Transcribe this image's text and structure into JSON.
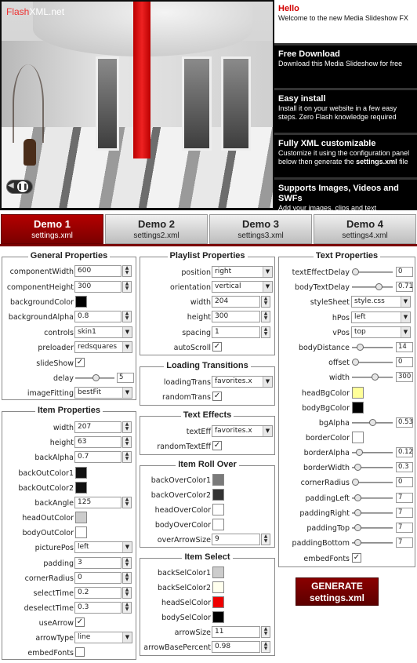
{
  "hero": {
    "logo_brand": "Flash",
    "logo_rest": "XML.net",
    "player_icon": "pause-icon",
    "items": [
      {
        "title": "Hello",
        "text": "Welcome to the new Media Slideshow FX"
      },
      {
        "title": "Free Download",
        "text": "Download this Media Slideshow for free"
      },
      {
        "title": "Easy install",
        "text": "Install it on your website in a few easy steps. Zero Flash knowledge required"
      },
      {
        "title": "Fully XML customizable",
        "text": "Customize it using the configuration panel below then generate the ",
        "text_bold": "settings.xml",
        "text_end": " file"
      },
      {
        "title": "Supports Images, Videos and SWFs",
        "text": "Add your images, clips and text"
      }
    ]
  },
  "tabs": [
    {
      "label": "Demo 1",
      "file": "settings.xml",
      "active": true
    },
    {
      "label": "Demo 2",
      "file": "settings2.xml"
    },
    {
      "label": "Demo 3",
      "file": "settings3.xml"
    },
    {
      "label": "Demo 4",
      "file": "settings4.xml"
    }
  ],
  "general": {
    "title": "General Properties",
    "componentWidth": {
      "label": "componentWidth",
      "value": "600"
    },
    "componentHeight": {
      "label": "componentHeight",
      "value": "300"
    },
    "backgroundColor": {
      "label": "backgroundColor",
      "color": "#000000"
    },
    "backgroundAlpha": {
      "label": "backgroundAlpha",
      "value": "0.8"
    },
    "controls": {
      "label": "controls",
      "value": "skin1"
    },
    "preloader": {
      "label": "preloader",
      "value": "redsquares"
    },
    "slideShow": {
      "label": "slideShow",
      "checked": true
    },
    "delay": {
      "label": "delay",
      "value": "5",
      "level": 0.5
    },
    "imageFitting": {
      "label": "imageFitting",
      "value": "bestFit"
    }
  },
  "item": {
    "title": "Item Properties",
    "width": {
      "label": "width",
      "value": "207"
    },
    "height": {
      "label": "height",
      "value": "63"
    },
    "backAlpha": {
      "label": "backAlpha",
      "value": "0.7"
    },
    "backOutColor1": {
      "label": "backOutColor1",
      "color": "#111111"
    },
    "backOutColor2": {
      "label": "backOutColor2",
      "color": "#111111"
    },
    "backAngle": {
      "label": "backAngle",
      "value": "125"
    },
    "headOutColor": {
      "label": "headOutColor",
      "color": "#cccccc"
    },
    "bodyOutColor": {
      "label": "bodyOutColor",
      "color": "#ffffff"
    },
    "picturePos": {
      "label": "picturePos",
      "value": "left"
    },
    "padding": {
      "label": "padding",
      "value": "3"
    },
    "cornerRadius": {
      "label": "cornerRadius",
      "value": "0"
    },
    "selectTime": {
      "label": "selectTime",
      "value": "0.2"
    },
    "deselectTime": {
      "label": "deselectTime",
      "value": "0.3"
    },
    "useArrow": {
      "label": "useArrow",
      "checked": true
    },
    "arrowType": {
      "label": "arrowType",
      "value": "line"
    },
    "embedFonts": {
      "label": "embedFonts",
      "checked": false
    }
  },
  "playlist": {
    "title": "Playlist Properties",
    "position": {
      "label": "position",
      "value": "right"
    },
    "orientation": {
      "label": "orientation",
      "value": "vertical"
    },
    "width": {
      "label": "width",
      "value": "204"
    },
    "height": {
      "label": "height",
      "value": "300"
    },
    "spacing": {
      "label": "spacing",
      "value": "1"
    },
    "autoScroll": {
      "label": "autoScroll",
      "checked": true
    }
  },
  "loading": {
    "title": "Loading Transitions",
    "loadingTrans": {
      "label": "loadingTrans",
      "value": "favorites.x"
    },
    "randomTrans": {
      "label": "randomTrans",
      "checked": true
    }
  },
  "effects": {
    "title": "Text Effects",
    "textEff": {
      "label": "textEff",
      "value": "favorites.x"
    },
    "randomTextEff": {
      "label": "randomTextEff",
      "checked": true
    }
  },
  "rollover": {
    "title": "Item Roll Over",
    "backOverColor1": {
      "label": "backOverColor1",
      "color": "#7a7a7a"
    },
    "backOverColor2": {
      "label": "backOverColor2",
      "color": "#333333"
    },
    "headOverColor": {
      "label": "headOverColor",
      "color": "#ffffff"
    },
    "bodyOverColor": {
      "label": "bodyOverColor",
      "color": "#ffffff"
    },
    "overArrowSize": {
      "label": "overArrowSize",
      "value": "9"
    }
  },
  "itemselect": {
    "title": "Item Select",
    "backSelColor1": {
      "label": "backSelColor1",
      "color": "#cccccc"
    },
    "backSelColor2": {
      "label": "backSelColor2",
      "color": "#ffffee"
    },
    "headSelColor": {
      "label": "headSelColor",
      "color": "#ee0000"
    },
    "bodySelColor": {
      "label": "bodySelColor",
      "color": "#000000"
    },
    "arrowSize": {
      "label": "arrowSize",
      "value": "11"
    },
    "arrowBasePercent": {
      "label": "arrowBasePercent",
      "value": "0.98"
    }
  },
  "text": {
    "title": "Text Properties",
    "textEffectDelay": {
      "label": "textEffectDelay",
      "value": "0",
      "level": 0.0
    },
    "bodyTextDelay": {
      "label": "bodyTextDelay",
      "value": "0.71",
      "level": 0.71
    },
    "styleSheet": {
      "label": "styleSheet",
      "value": "style.css"
    },
    "hPos": {
      "label": "hPos",
      "value": "left"
    },
    "vPos": {
      "label": "vPos",
      "value": "top"
    },
    "bodyDistance": {
      "label": "bodyDistance",
      "value": "14",
      "level": 0.14
    },
    "offset": {
      "label": "offset",
      "value": "0",
      "level": 0.0
    },
    "width": {
      "label": "width",
      "value": "300",
      "level": 0.6
    },
    "headBgColor": {
      "label": "headBgColor",
      "color": "#ffff99"
    },
    "bodyBgColor": {
      "label": "bodyBgColor",
      "color": "#000000"
    },
    "bgAlpha": {
      "label": "bgAlpha",
      "value": "0.53",
      "level": 0.53
    },
    "borderColor": {
      "label": "borderColor",
      "color": "#ffffff"
    },
    "borderAlpha": {
      "label": "borderAlpha",
      "value": "0.12",
      "level": 0.12
    },
    "borderWidth": {
      "label": "borderWidth",
      "value": "0.3",
      "level": 0.06
    },
    "cornerRadius": {
      "label": "cornerRadius",
      "value": "0",
      "level": 0.0
    },
    "paddingLeft": {
      "label": "paddingLeft",
      "value": "7",
      "level": 0.07
    },
    "paddingRight": {
      "label": "paddingRight",
      "value": "7",
      "level": 0.07
    },
    "paddingTop": {
      "label": "paddingTop",
      "value": "7",
      "level": 0.07
    },
    "paddingBottom": {
      "label": "paddingBottom",
      "value": "7",
      "level": 0.07
    },
    "embedFonts": {
      "label": "embedFonts",
      "checked": true
    }
  },
  "generate": {
    "line1": "GENERATE",
    "line2": "settings.xml"
  }
}
